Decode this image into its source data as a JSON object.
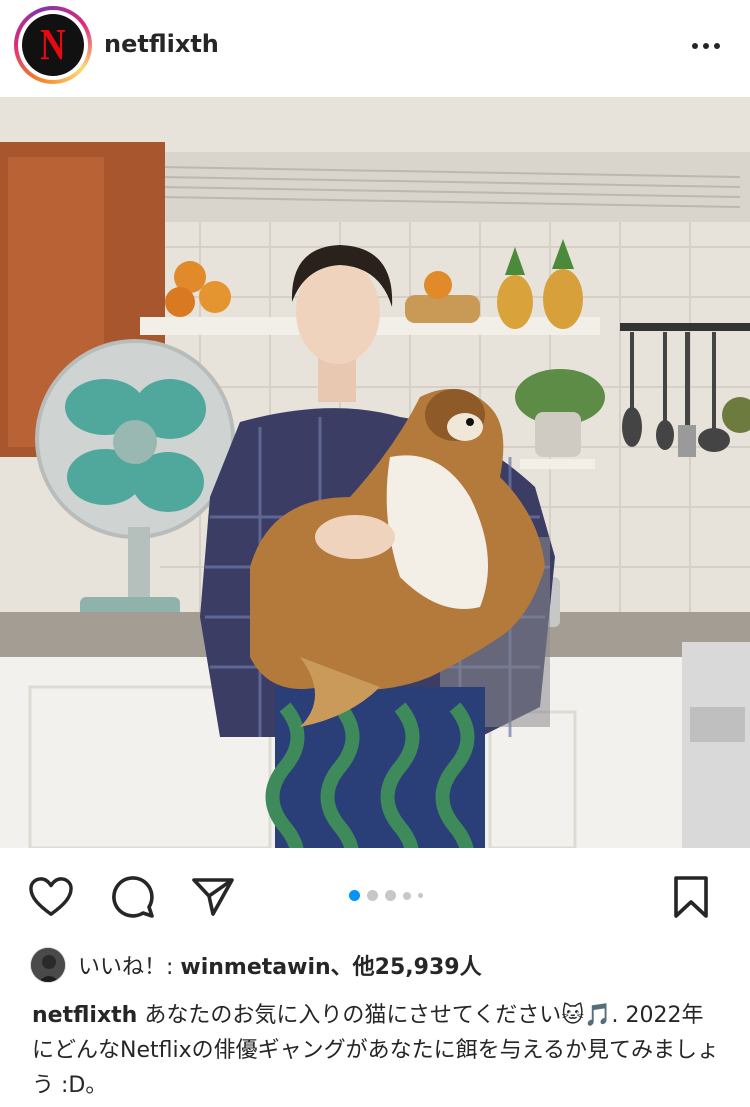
{
  "post": {
    "username": "netflixth",
    "avatar_letter": "N",
    "more_icon": "more-horizontal-icon"
  },
  "photo": {
    "alt": "",
    "carousel_index": 1,
    "carousel_count": 5
  },
  "actions": {
    "like_icon": "heart-icon",
    "comment_icon": "comment-icon",
    "share_icon": "send-icon",
    "save_icon": "bookmark-icon"
  },
  "likes": {
    "prefix": "いいね！: ",
    "liker": "winmetawin",
    "suffix": "、他25,939人"
  },
  "caption": {
    "username": "netflixth",
    "text": " あなたのお気に入りの猫にさせてください🐱🎵. 2022年にどんなNetflixの俳優ギャングがあなたに餌を与えるか見てみましょう :D。"
  },
  "colors": {
    "accent_blue": "#0095f6",
    "netflix_red": "#e50914",
    "text": "#262626"
  }
}
